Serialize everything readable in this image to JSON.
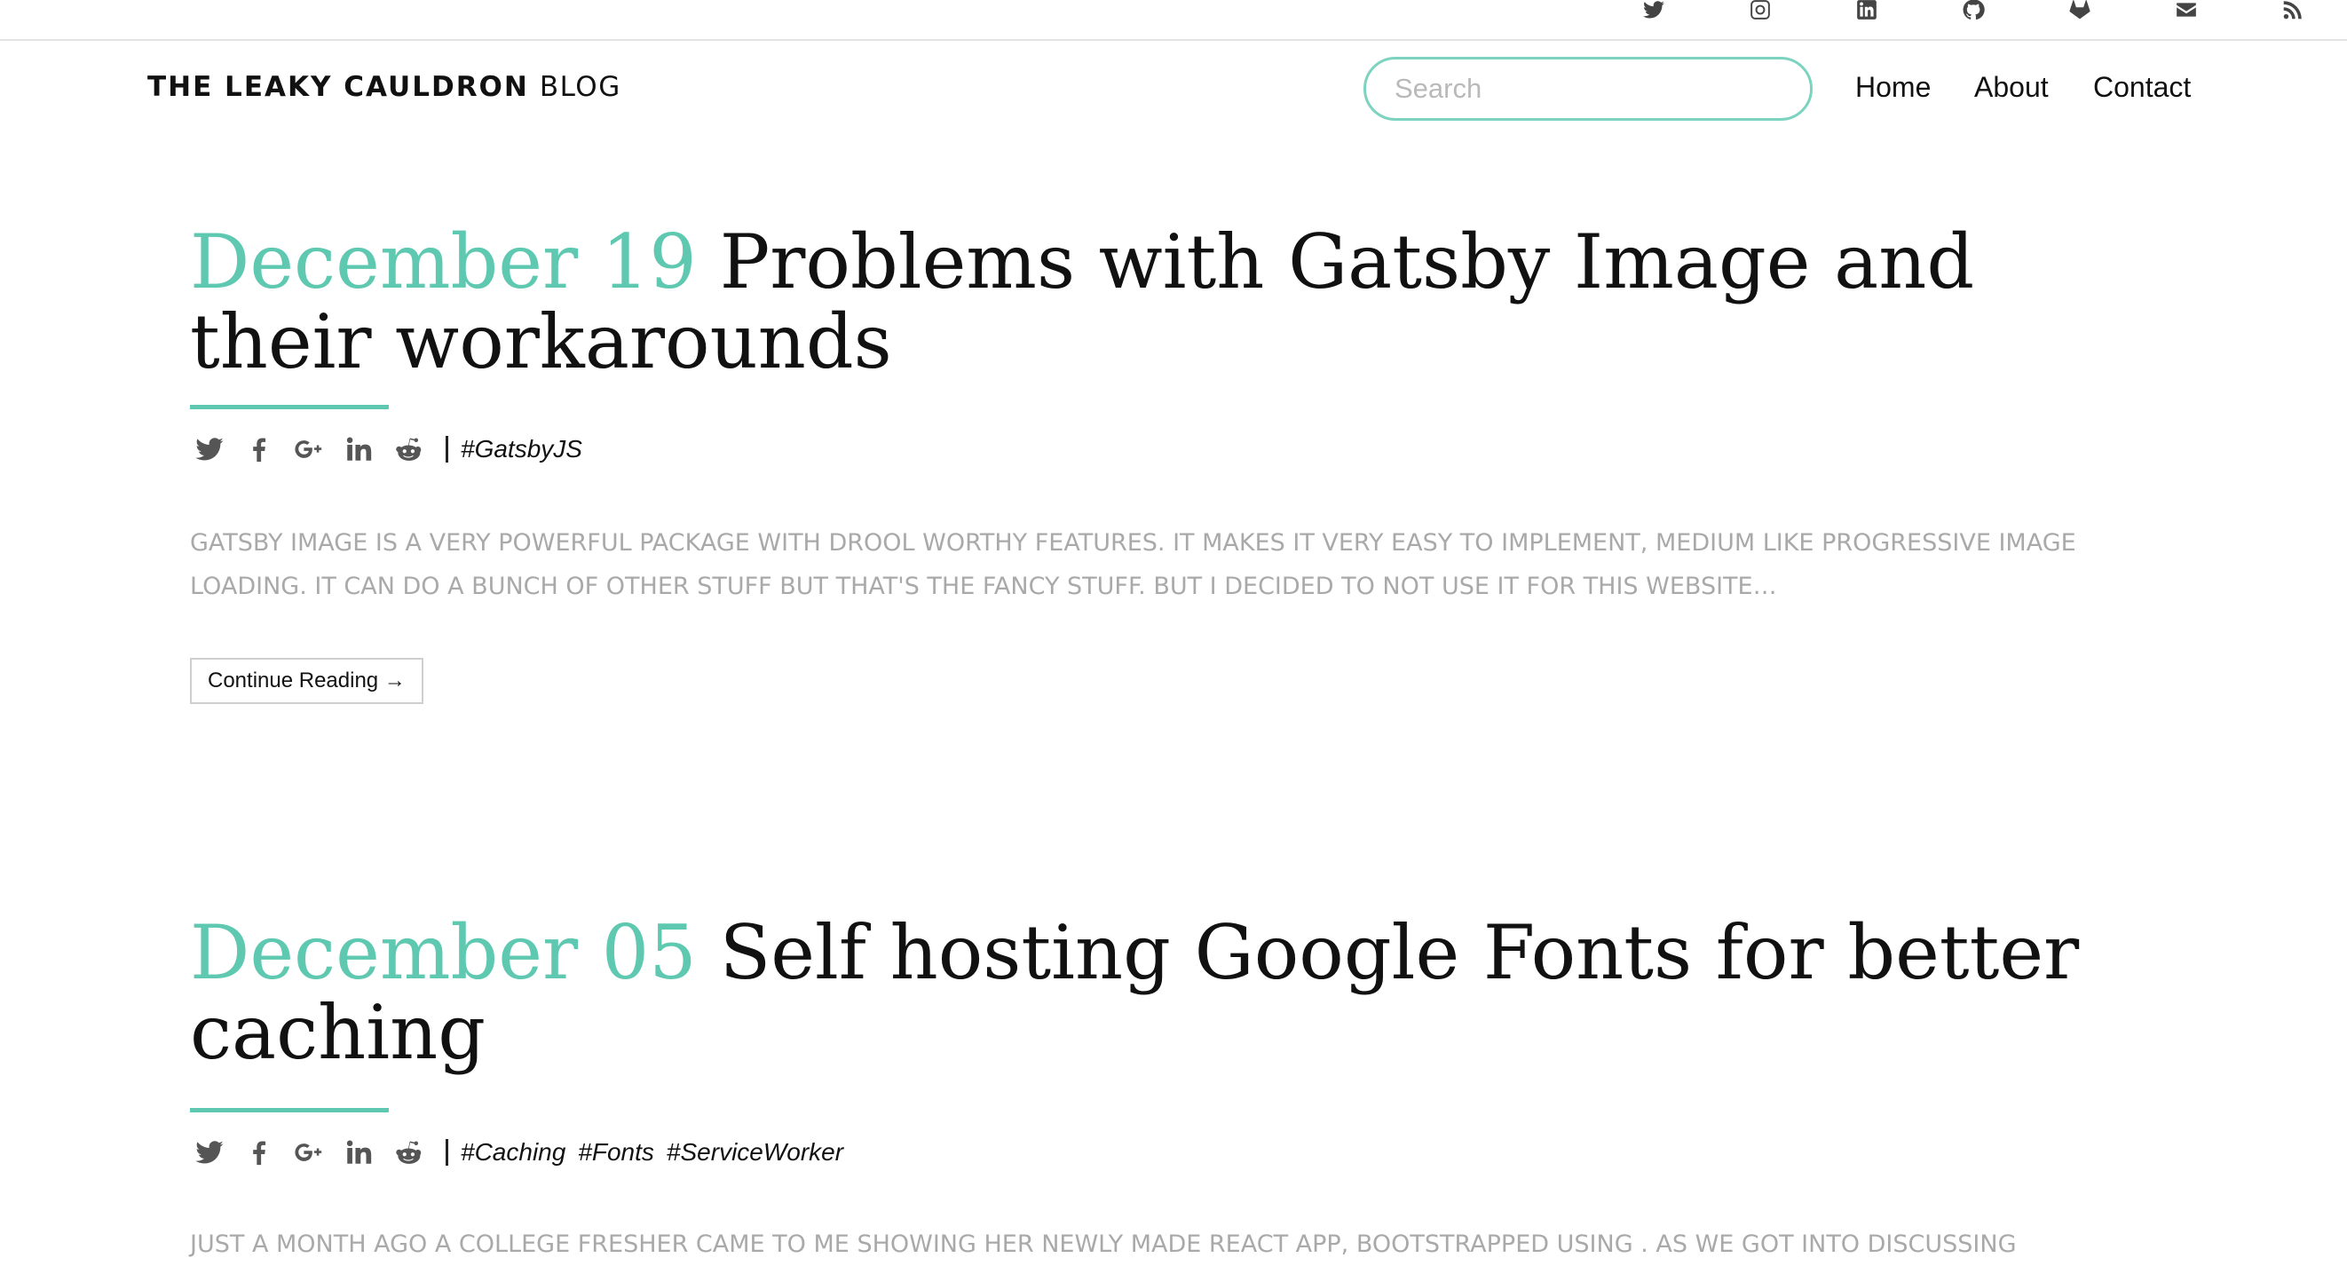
{
  "social": [
    {
      "icon": "twitter-icon"
    },
    {
      "icon": "instagram-icon"
    },
    {
      "icon": "linkedin-icon"
    },
    {
      "icon": "github-icon"
    },
    {
      "icon": "gitlab-icon"
    },
    {
      "icon": "email-icon"
    },
    {
      "icon": "rss-icon"
    }
  ],
  "brand": {
    "name": "THE LEAKY CAULDRON",
    "suffix": "BLOG"
  },
  "search": {
    "placeholder": "Search",
    "value": ""
  },
  "nav": {
    "home": "Home",
    "about": "About",
    "contact": "Contact"
  },
  "posts": [
    {
      "date": "December 19",
      "title": "Problems with Gatsby Image and their workarounds",
      "tags": [
        "#GatsbyJS"
      ],
      "excerpt": "GATSBY IMAGE IS A VERY POWERFUL PACKAGE WITH DROOL WORTHY FEATURES. IT MAKES IT VERY EASY TO IMPLEMENT, MEDIUM LIKE PROGRESSIVE IMAGE LOADING. IT CAN DO A BUNCH OF OTHER STUFF BUT THAT'S THE FANCY STUFF. BUT I DECIDED TO NOT USE IT FOR THIS WEBSITE…",
      "button": "Continue Reading →"
    },
    {
      "date": "December 05",
      "title": "Self hosting Google Fonts for better caching",
      "tags": [
        "#Caching",
        "#Fonts",
        "#ServiceWorker"
      ],
      "excerpt": "JUST A MONTH AGO A COLLEGE FRESHER CAME TO ME SHOWING HER NEWLY MADE REACT APP, BOOTSTRAPPED USING . AS WE GOT INTO DISCUSSING"
    }
  ],
  "share_icons": [
    "twitter-icon",
    "facebook-icon",
    "google-plus-icon",
    "linkedin-icon",
    "reddit-icon"
  ],
  "colors": {
    "accent": "#5fc8b0",
    "search_border": "#7cd3bf",
    "excerpt": "#a9a9a9"
  }
}
